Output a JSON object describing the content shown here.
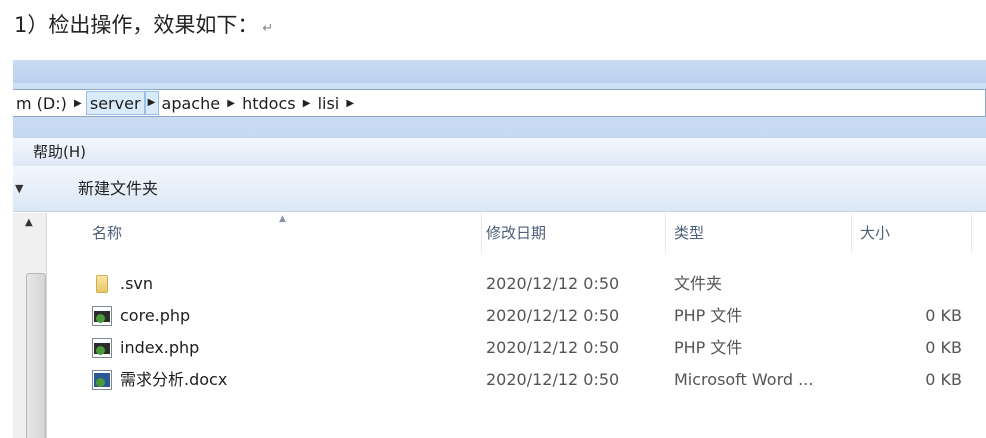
{
  "caption": {
    "text": "1）检出操作，效果如下：",
    "return_mark": "↵"
  },
  "address": {
    "crumbs": [
      "m (D:)",
      "server",
      "apache",
      "htdocs",
      "lisi"
    ]
  },
  "menu": {
    "help": "帮助(H)"
  },
  "toolbar": {
    "new_folder": "新建文件夹"
  },
  "columns": {
    "name": "名称",
    "date": "修改日期",
    "type": "类型",
    "size": "大小"
  },
  "files": [
    {
      "name": ".svn",
      "date": "2020/12/12 0:50",
      "type": "文件夹",
      "size": "",
      "icon": "folder-icon"
    },
    {
      "name": "core.php",
      "date": "2020/12/12 0:50",
      "type": "PHP 文件",
      "size": "0 KB",
      "icon": "php-file-icon"
    },
    {
      "name": "index.php",
      "date": "2020/12/12 0:50",
      "type": "PHP 文件",
      "size": "0 KB",
      "icon": "php-file-icon"
    },
    {
      "name": "需求分析.docx",
      "date": "2020/12/12 0:50",
      "type": "Microsoft Word ...",
      "size": "0 KB",
      "icon": "word-doc-icon"
    }
  ]
}
